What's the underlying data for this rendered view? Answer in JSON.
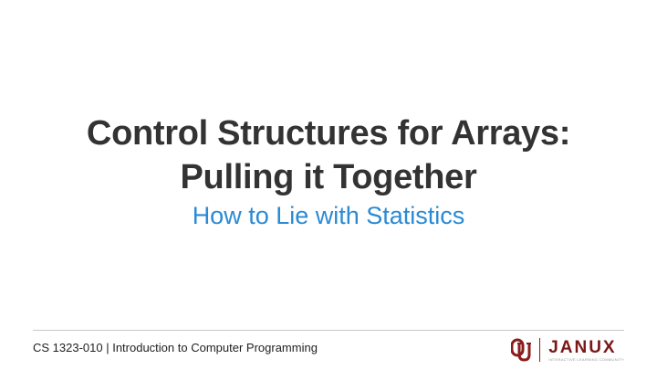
{
  "slide": {
    "title_line1": "Control Structures for Arrays:",
    "title_line2": "Pulling it Together",
    "subtitle": "How to Lie with Statistics"
  },
  "footer": {
    "course": "CS 1323-010 | Introduction to Computer Programming"
  },
  "branding": {
    "ou_logo_icon": "ou-interlocking-logo-icon",
    "janux_wordmark": "JANUX",
    "janux_tagline": "INTERACTIVE LEARNING COMMUNITY"
  },
  "colors": {
    "title": "#333333",
    "subtitle": "#2a8ad4",
    "brand_crimson": "#7a1818"
  }
}
